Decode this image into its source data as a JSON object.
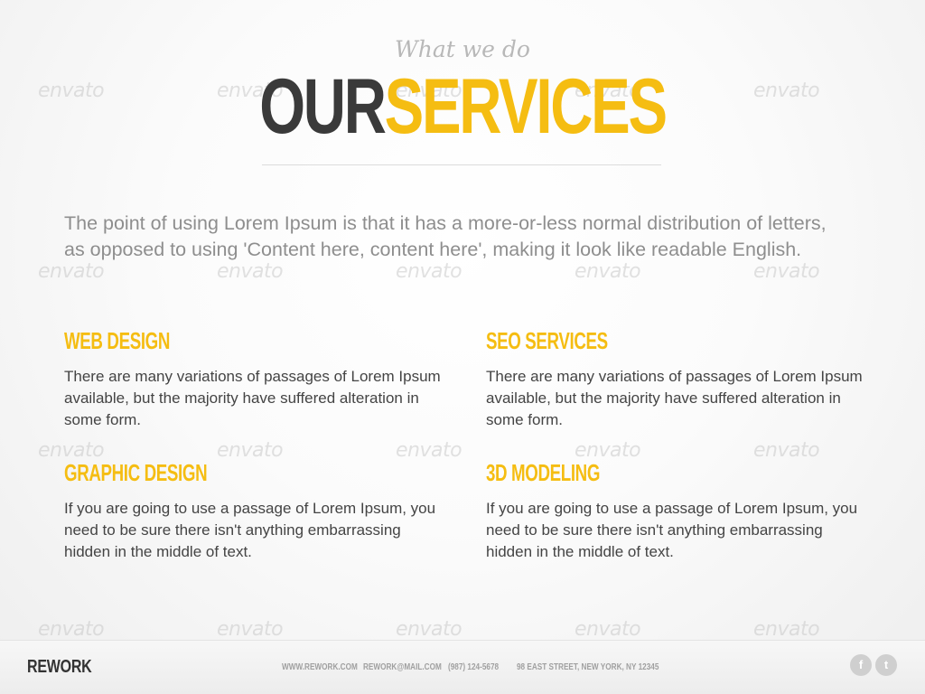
{
  "watermark": {
    "text": "envato"
  },
  "header": {
    "subtitle": "What we do",
    "title_dark": "OUR",
    "title_accent": "SERVICES"
  },
  "intro": "The point of using Lorem Ipsum is that it has a more-or-less normal distribution of letters, as opposed to using 'Content here, content here', making it look like readable English.",
  "services": [
    {
      "title": "WEB DESIGN",
      "description": "There are many variations of passages of Lorem Ipsum available, but the majority have suffered alteration in some form."
    },
    {
      "title": "SEO SERVICES",
      "description": "There are many variations of passages of Lorem Ipsum available, but the majority have suffered alteration in some form."
    },
    {
      "title": "GRAPHIC DESIGN",
      "description": "If you are going to use a passage of Lorem Ipsum, you need to be sure there isn't anything embarrassing hidden in the middle of text."
    },
    {
      "title": "3D MODELING",
      "description": "If you are going to use a passage of Lorem Ipsum, you need to be sure there isn't anything embarrassing hidden in the middle of text."
    }
  ],
  "footer": {
    "brand": "REWORK",
    "website": "WWW.REWORK.COM",
    "email": "REWORK@MAIL.COM",
    "phone": "(987) 124-5678",
    "address": "98 EAST STREET, NEW YORK, NY 12345",
    "social": [
      {
        "icon": "facebook-icon",
        "glyph": "f"
      },
      {
        "icon": "twitter-icon",
        "glyph": "t"
      }
    ]
  },
  "colors": {
    "accent": "#f5bd12",
    "dark": "#3a3a3a",
    "muted": "#8e8e8e"
  }
}
